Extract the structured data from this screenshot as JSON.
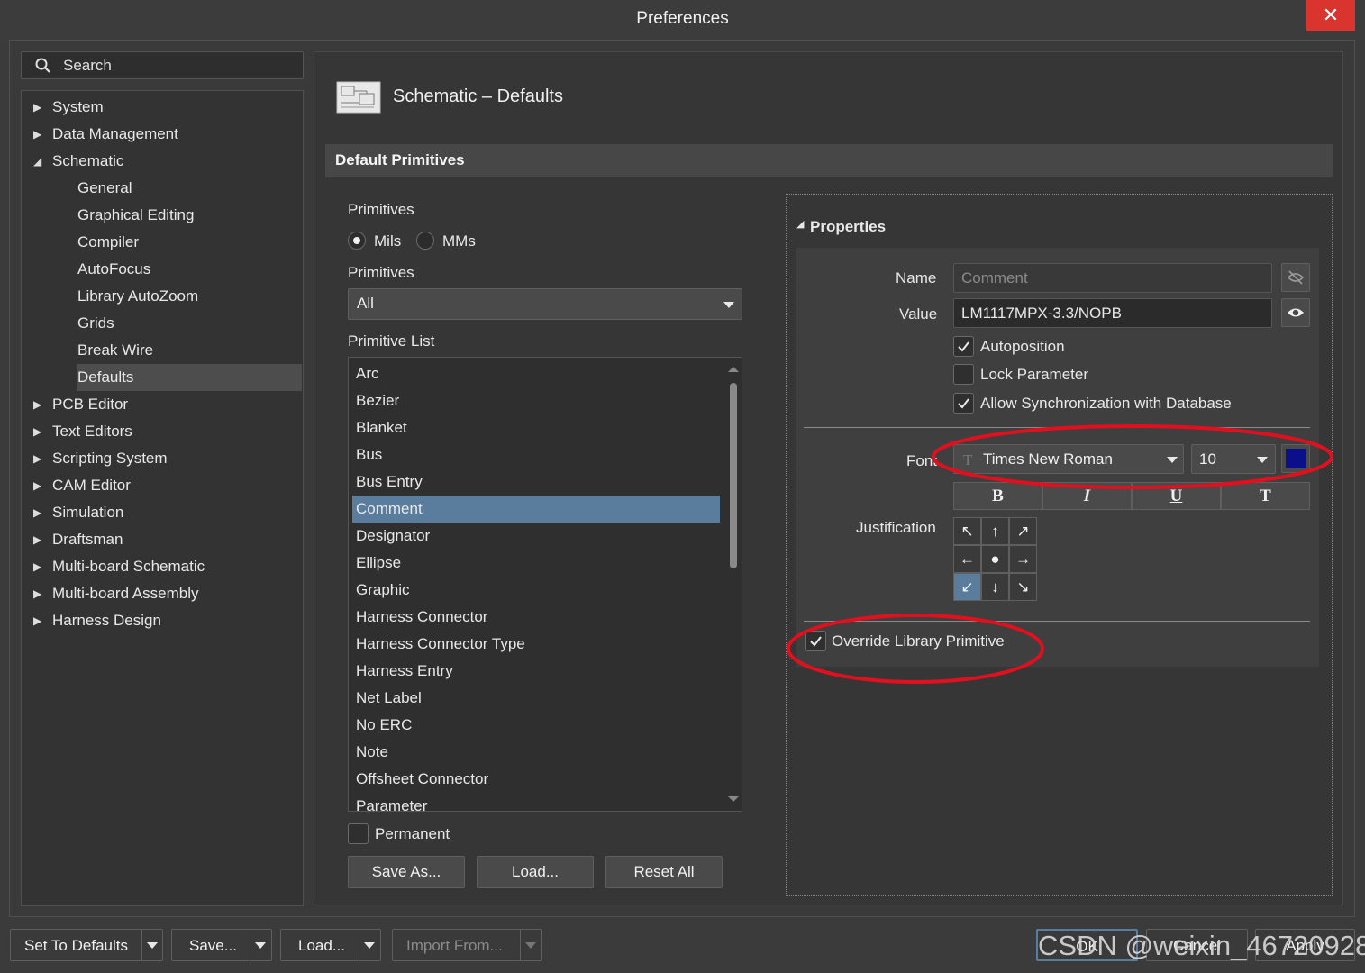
{
  "window": {
    "title": "Preferences",
    "close_glyph": "✕"
  },
  "search": {
    "placeholder": "Search"
  },
  "tree": {
    "items": [
      {
        "label": "System",
        "expanded": false
      },
      {
        "label": "Data Management",
        "expanded": false
      },
      {
        "label": "Schematic",
        "expanded": true
      },
      {
        "label": "General"
      },
      {
        "label": "Graphical Editing"
      },
      {
        "label": "Compiler"
      },
      {
        "label": "AutoFocus"
      },
      {
        "label": "Library AutoZoom"
      },
      {
        "label": "Grids"
      },
      {
        "label": "Break Wire"
      },
      {
        "label": "Defaults",
        "selected": true
      },
      {
        "label": "PCB Editor",
        "expanded": false
      },
      {
        "label": "Text Editors",
        "expanded": false
      },
      {
        "label": "Scripting System",
        "expanded": false
      },
      {
        "label": "CAM Editor",
        "expanded": false
      },
      {
        "label": "Simulation",
        "expanded": false
      },
      {
        "label": "Draftsman",
        "expanded": false
      },
      {
        "label": "Multi-board Schematic",
        "expanded": false
      },
      {
        "label": "Multi-board Assembly",
        "expanded": false
      },
      {
        "label": "Harness Design",
        "expanded": false
      }
    ]
  },
  "page": {
    "title": "Schematic – Defaults",
    "section": "Default Primitives"
  },
  "primitives": {
    "units_label": "Primitives",
    "unit_mils": "Mils",
    "unit_mms": "MMs",
    "selected_unit": "Mils",
    "filter_label": "Primitives",
    "filter_value": "All",
    "list_label": "Primitive List",
    "list": [
      "Arc",
      "Bezier",
      "Blanket",
      "Bus",
      "Bus Entry",
      "Comment",
      "Designator",
      "Ellipse",
      "Graphic",
      "Harness Connector",
      "Harness Connector Type",
      "Harness Entry",
      "Net Label",
      "No ERC",
      "Note",
      "Offsheet Connector",
      "Parameter"
    ],
    "selected_item": "Comment",
    "permanent_label": "Permanent",
    "permanent_checked": false,
    "save_as": "Save As...",
    "load": "Load...",
    "reset_all": "Reset All"
  },
  "properties": {
    "header": "Properties",
    "name_label": "Name",
    "name_value": "Comment",
    "value_label": "Value",
    "value_value": "LM1117MPX-3.3/NOPB",
    "autoposition": "Autoposition",
    "autoposition_checked": true,
    "lock_parameter": "Lock Parameter",
    "lock_parameter_checked": false,
    "allow_sync": "Allow Synchronization with Database",
    "allow_sync_checked": true,
    "font_label": "Font",
    "font_name": "Times New Roman",
    "font_size": "10",
    "font_color": "#0b0f8a",
    "bold": "B",
    "italic": "I",
    "underline": "U",
    "strike": "T",
    "justification_label": "Justification",
    "justification_cells": [
      "↖",
      "↑",
      "↗",
      "←",
      "●",
      "→",
      "↙",
      "↓",
      "↘"
    ],
    "justification_selected": 6,
    "override_label": "Override Library Primitive",
    "override_checked": true
  },
  "footer": {
    "set_to_defaults": "Set To Defaults",
    "save": "Save...",
    "load": "Load...",
    "import_from": "Import From...",
    "ok": "OK",
    "cancel": "Cancel",
    "apply": "Apply"
  },
  "watermark": "CSDN @weixin_46720928",
  "colors": {
    "accent_selection": "#5a7d9e",
    "annotation_red": "#e0101e",
    "close_red": "#d9352e"
  }
}
